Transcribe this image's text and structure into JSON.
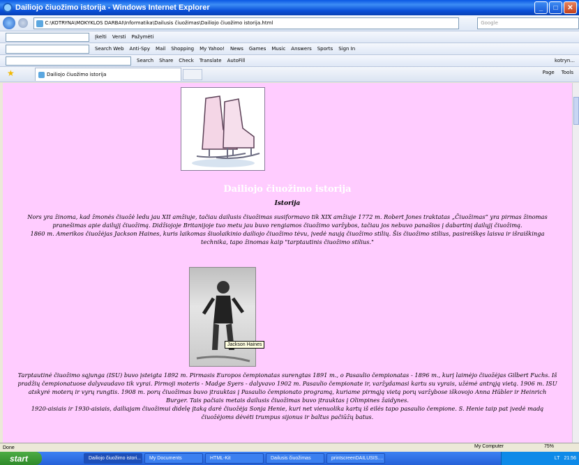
{
  "window": {
    "title": "Dailiojo čiuožimo istorija - Windows Internet Explorer"
  },
  "address": {
    "url": "C:\\KOTRYNA\\MOKYKLOS DARBAI\\Informatika\\Dailusis čiuožimas\\Dailiojo čiuožimo istorija.html"
  },
  "search": {
    "placeholder": "Google"
  },
  "toolbars": {
    "row1": [
      "Įkelti",
      "Versti",
      "Pažymėti"
    ],
    "row2": [
      "Search Web",
      "Anti-Spy",
      "Mail",
      "Shopping",
      "My Yahoo!",
      "News",
      "Games",
      "Music",
      "Answers",
      "Sports",
      "Sign In"
    ],
    "row3": [
      "Search",
      "Share",
      "Check",
      "Translate",
      "AutoFill",
      "kotryn..."
    ]
  },
  "tab": {
    "label": "Dailiojo čiuožimo istorija"
  },
  "commands": [
    "Page",
    "Tools"
  ],
  "page": {
    "heading": "Dailiojo čiuožimo istorija",
    "subheading": "Istorija",
    "p1a": "Nors yra žinoma, kad žmonės čiuožė ledu jau XII amžiuje, tačiau dailusis čiuožimas susiformavo tik XIX amžiuje 1772 m. Robert Jones traktatas „Čiuožimas“ yra pirmas žinomas pranešimas apie dailųjį čiuožimą. Didžiojoje Britanijoje tuo metu jau buvo rengiamos čiuožimo varžybos, tačiau jos nebuvo panašios į dabartinį dailųjį čiuožimą.",
    "p1b": "1860 m. Amerikos čiuožėjas Jackson Haines, kuris laikomas šiuolaikinio dailiojo čiuožimo tėvu, įvedė naują čiuožimo stilių. Šis čiuožimo stilius, pasireiškęs laisva ir išraiškinga technika, tapo žinomas kaip \"tarptautinis čiuožimo stilius.\"",
    "photo_tooltip": "Jackson Haines",
    "p2a": "Tarptautinė čiuožimo sąjunga (ISU) buvo įsteigta 1892 m. Pirmasis Europos čempionatas surengtas 1891 m., o Pasaulio čempionatas - 1896 m., kurį laimėjo čiuožėjas Gilbert Fuchs. Iš pradžių čempionatuose dalyvaudavo tik vyrai. Pirmoji moteris - Madge Syers - dalyvavo 1902 m. Pasaulio čempionate ir, varžydamasi kartu su vyrais, užėmė antrąją vietą. 1906 m. ISU atskyrė moterų ir vyrų rungtis. 1908 m. porų čiuožimas buvo įtrauktas į Pasaulio čempionato programą, kuriame pirmąją vietą porų varžybose iškovojo Anna Hübler ir Heinrich Burger. Tais pačiais metais dailusis čiuožimas buvo įtrauktas į Olimpines žaidynes.",
    "p2b": "1920-aisiais ir 1930-aisiais, dailiajam čiuožimui didelę įtaką darė čiuožėja Sonja Henie, kuri net vienuolika kartų iš eilės tapo pasaulio čempione. S. Henie taip pat įvedė madą čiuožėjoms dėvėti trumpus sijonus ir baltus pačiūžų batus."
  },
  "status": {
    "text": "Done",
    "zone": "My Computer",
    "zoom": "75%"
  },
  "taskbar": {
    "start": "start",
    "tasks": [
      "Dailiojo čiuožimo istori...",
      "My Documents",
      "HTML-Kit",
      "Dailusis čiuožimas",
      "printscreenDAILUSIS...."
    ],
    "clock": "21:56",
    "lang": "LT"
  }
}
